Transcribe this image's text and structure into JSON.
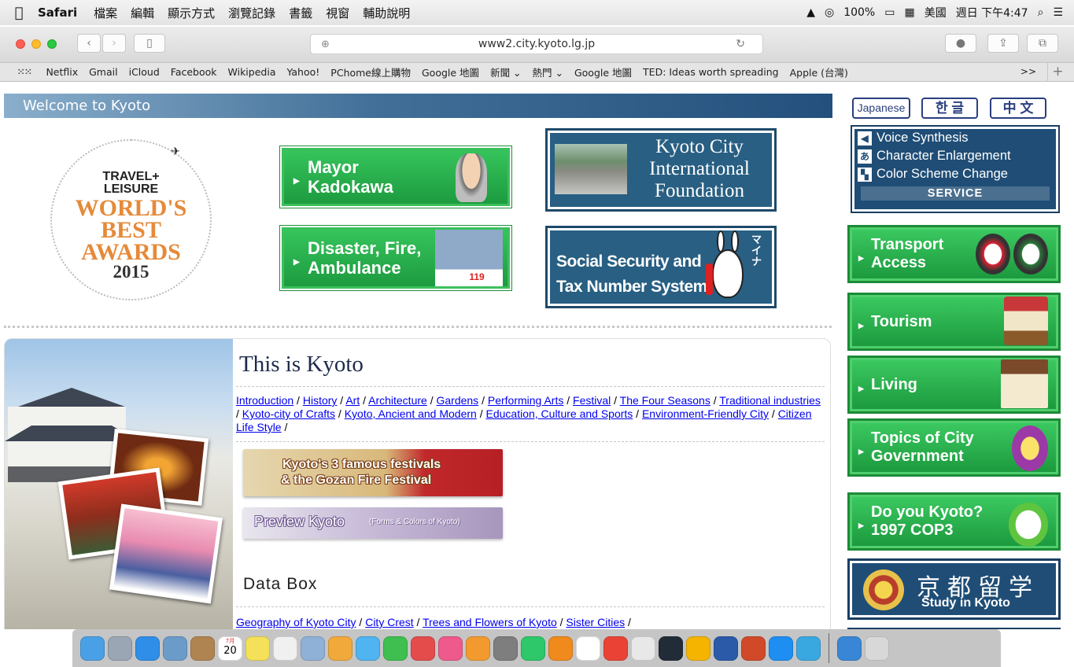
{
  "menubar": {
    "app": "Safari",
    "items": [
      "檔案",
      "編輯",
      "顯示方式",
      "瀏覽記錄",
      "書籤",
      "視窗",
      "輔助說明"
    ],
    "battery": "100%",
    "input_source": "美國",
    "clock": "週日 下午4:47"
  },
  "toolbar": {
    "url": "www2.city.kyoto.lg.jp"
  },
  "bookmarks": [
    "Netflix",
    "Gmail",
    "iCloud",
    "Facebook",
    "Wikipedia",
    "Yahoo!",
    "PChome線上購物",
    "Google 地圖",
    "新聞 ⌄",
    "熱門 ⌄",
    "Google 地圖",
    "TED: Ideas worth spreading",
    "Apple (台灣)"
  ],
  "bookmarks_more": ">>",
  "page": {
    "welcome": "Welcome to Kyoto",
    "award": {
      "line1": "TRAVEL+\nLEISURE",
      "line2": "WORLD'S\nBEST\nAWARDS",
      "year": "2015"
    },
    "mayor": {
      "line1": "Mayor",
      "line2": "Kadokawa"
    },
    "disaster": {
      "line1": "Disaster, Fire,",
      "line2": "Ambulance",
      "number": "119"
    },
    "kcif": {
      "line1": "Kyoto City",
      "line2": "International",
      "line3": "Foundation"
    },
    "ssn": {
      "line1": "Social Security and",
      "line2": "Tax Number System"
    },
    "section_title": "This is Kyoto",
    "links": [
      "Introduction",
      "History",
      "Art",
      "Architecture",
      "Gardens",
      "Performing Arts",
      "Festival",
      "The Four Seasons",
      "Traditional industries",
      "Kyoto-city of Crafts",
      "Kyoto, Ancient and Modern",
      "Education, Culture and Sports",
      "Environment-Friendly City",
      "Citizen Life Style"
    ],
    "fest_banner": {
      "line1": "Kyoto's 3 famous festivals",
      "line2": "& the Gozan Fire Festival"
    },
    "preview_banner": {
      "big": "Preview Kyoto",
      "small": "(Forms & Colors of Kyoto)"
    },
    "databox": "Data Box",
    "links2": [
      "Geography of Kyoto City",
      "City Crest",
      "Trees and Flowers of Kyoto",
      "Sister Cities"
    ]
  },
  "sidebar": {
    "langs": [
      "Japanese",
      "한 글",
      "中 文"
    ],
    "service": {
      "voice": "Voice Synthesis",
      "char": "Character Enlargement",
      "color": "Color Scheme Change",
      "label": "SERVICE"
    },
    "buttons": [
      {
        "line1": "Transport",
        "line2": "Access"
      },
      {
        "line1": "Tourism",
        "line2": ""
      },
      {
        "line1": "Living",
        "line2": ""
      },
      {
        "line1": "Topics of City",
        "line2": "Government"
      },
      {
        "line1": "Do you Kyoto?",
        "line2": "1997 COP3"
      }
    ],
    "study": {
      "kanji": "京都留学",
      "en": "Study in Kyoto"
    }
  },
  "dock": {
    "calendar_month": "7月",
    "calendar_day": "20",
    "colors": [
      "#4aa0e6",
      "#9aa6b4",
      "#2f8ee8",
      "#6b9bc9",
      "#b08451",
      "#ffffff",
      "#f5e05a",
      "#f0f0f0",
      "#8fb1d8",
      "#f2a93b",
      "#4fb4f0",
      "#3fbf4f",
      "#e44c4c",
      "#ee5a8c",
      "#f29a2e",
      "#7e7e7e",
      "#2ec76a",
      "#f08a1c",
      "#ffffff",
      "#ea4335",
      "#e8e8e8",
      "#222c39",
      "#f4b400",
      "#2b5aa8",
      "#d04a2a",
      "#1e8ef2",
      "#3aa8e0",
      "#3a86d6",
      "#d8d8d8"
    ]
  }
}
